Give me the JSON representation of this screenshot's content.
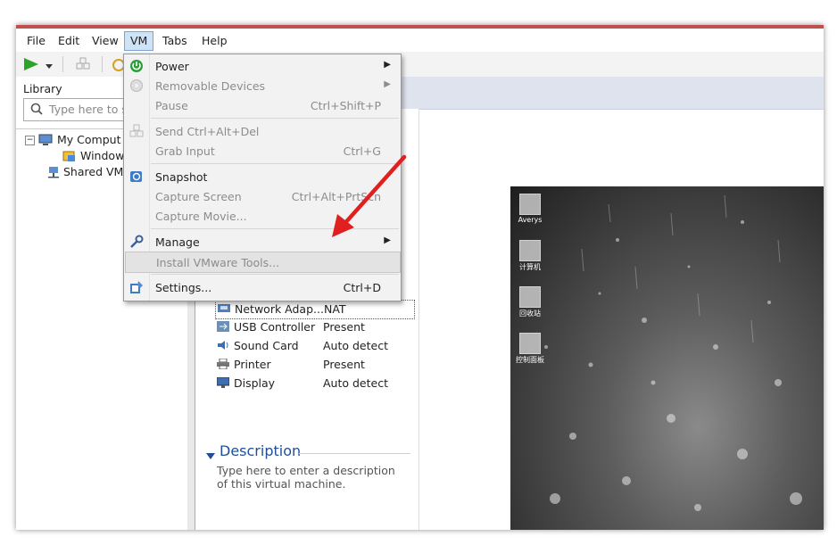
{
  "menubar": {
    "items": [
      {
        "label": "File"
      },
      {
        "label": "Edit"
      },
      {
        "label": "View"
      },
      {
        "label": "VM"
      },
      {
        "label": "Tabs"
      },
      {
        "label": "Help"
      }
    ]
  },
  "library": {
    "title": "Library",
    "search_placeholder": "Type here to s",
    "tree": {
      "my_computer": "My Comput",
      "windows_vm": "Window",
      "shared_vms": "Shared VMs"
    }
  },
  "vm_menu": {
    "items": [
      {
        "label": "Power",
        "shortcut": "",
        "submenu": true,
        "enabled": true,
        "icon": "power-icon"
      },
      {
        "label": "Removable Devices",
        "shortcut": "",
        "submenu": true,
        "enabled": false,
        "icon": "disc-icon"
      },
      {
        "label": "Pause",
        "shortcut": "Ctrl+Shift+P",
        "submenu": false,
        "enabled": false,
        "icon": ""
      },
      {
        "label": "Send Ctrl+Alt+Del",
        "shortcut": "",
        "submenu": false,
        "enabled": false,
        "icon": "network-icon"
      },
      {
        "label": "Grab Input",
        "shortcut": "Ctrl+G",
        "submenu": false,
        "enabled": false,
        "icon": ""
      },
      {
        "label": "Snapshot",
        "shortcut": "",
        "submenu": false,
        "enabled": true,
        "icon": "snapshot-icon"
      },
      {
        "label": "Capture Screen",
        "shortcut": "Ctrl+Alt+PrtScn",
        "submenu": false,
        "enabled": false,
        "icon": ""
      },
      {
        "label": "Capture Movie...",
        "shortcut": "",
        "submenu": false,
        "enabled": false,
        "icon": ""
      },
      {
        "label": "Manage",
        "shortcut": "",
        "submenu": true,
        "enabled": true,
        "icon": "wrench-icon"
      },
      {
        "label": "Install VMware Tools...",
        "shortcut": "",
        "submenu": false,
        "enabled": false,
        "icon": ""
      },
      {
        "label": "Settings...",
        "shortcut": "Ctrl+D",
        "submenu": false,
        "enabled": true,
        "icon": "settings-icon"
      }
    ]
  },
  "devices": [
    {
      "name": "Network Adap...",
      "value": "NAT",
      "icon": "network-adapter-icon"
    },
    {
      "name": "USB Controller",
      "value": "Present",
      "icon": "usb-icon"
    },
    {
      "name": "Sound Card",
      "value": "Auto detect",
      "icon": "speaker-icon"
    },
    {
      "name": "Printer",
      "value": "Present",
      "icon": "printer-icon"
    },
    {
      "name": "Display",
      "value": "Auto detect",
      "icon": "display-icon"
    }
  ],
  "description": {
    "heading": "Description",
    "text": "Type here to enter a description of this virtual machine."
  },
  "desktop_icons": [
    {
      "label": "Averys"
    },
    {
      "label": "计算机"
    },
    {
      "label": "回收站"
    },
    {
      "label": "控制面板"
    }
  ],
  "colors": {
    "accent_red": "#e02020",
    "menu_highlight": "#cfe3f7",
    "desc_blue": "#1f4e9a"
  }
}
